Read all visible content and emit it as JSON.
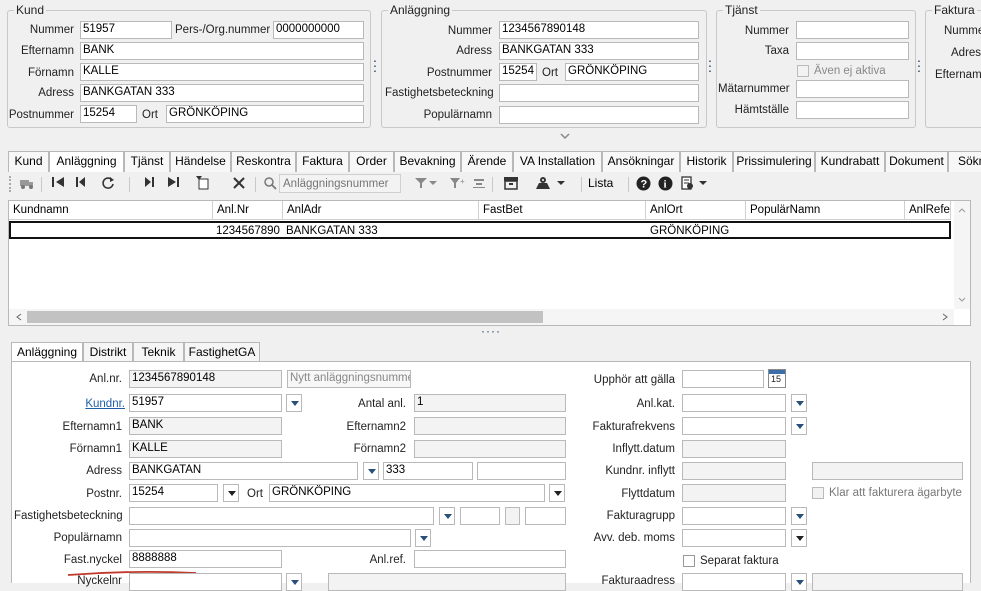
{
  "kund": {
    "title": "Kund",
    "nummer_label": "Nummer",
    "nummer": "51957",
    "persorg_label": "Pers-/Org.nummer",
    "persorg": "0000000000",
    "efternamn_label": "Efternamn",
    "efternamn": "BANK",
    "fornamn_label": "Förnamn",
    "fornamn": "KALLE",
    "adress_label": "Adress",
    "adress": "BANKGATAN 333",
    "postnummer_label": "Postnummer",
    "postnummer": "15254",
    "ort_label": "Ort",
    "ort": "GRÖNKÖPING"
  },
  "anlaggning": {
    "title": "Anläggning",
    "nummer_label": "Nummer",
    "nummer": "1234567890148",
    "adress_label": "Adress",
    "adress": "BANKGATAN 333",
    "postnummer_label": "Postnummer",
    "postnummer": "15254",
    "ort_label": "Ort",
    "ort": "GRÖNKÖPING",
    "fastighet_label": "Fastighetsbeteckning",
    "fastighet": "",
    "popular_label": "Populärnamn",
    "popular": ""
  },
  "tjanst": {
    "title": "Tjänst",
    "nummer_label": "Nummer",
    "taxa_label": "Taxa",
    "aven_label": "Även ej aktiva",
    "matarnummer_label": "Mätarnummer",
    "hamtstalle_label": "Hämtställe"
  },
  "faktura": {
    "title": "Faktura",
    "nummer_label": "Nummer",
    "adress_label": "Adress",
    "efternamn_label": "Efternamn"
  },
  "tabs": [
    "Kund",
    "Anläggning",
    "Tjänst",
    "Händelse",
    "Reskontra",
    "Faktura",
    "Order",
    "Bevakning",
    "Ärende",
    "VA Installation",
    "Ansökningar",
    "Historik",
    "Prissimulering",
    "Kundrabatt",
    "Dokument",
    "Sökn"
  ],
  "toolbar": {
    "search_placeholder": "Anläggningsnummer",
    "lista_label": "Lista"
  },
  "grid": {
    "columns": [
      "Kundnamn",
      "Anl.Nr",
      "AnlAdr",
      "FastBet",
      "AnlOrt",
      "PopulärNamn",
      "AnlRefere"
    ],
    "rows": [
      [
        "",
        "1234567890",
        "BANKGATAN 333",
        "",
        "GRÖNKÖPING",
        "",
        ""
      ]
    ]
  },
  "subtabs": [
    "Anläggning",
    "Distrikt",
    "Teknik",
    "FastighetGA"
  ],
  "form": {
    "anlnr_label": "Anl.nr.",
    "anlnr": "1234567890148",
    "nytt_button": "Nytt anläggningsnummer",
    "kundnr_label": "Kundnr.",
    "kundnr": "51957",
    "antalanl_label": "Antal anl.",
    "antalanl": "1",
    "efternamn1_label": "Efternamn1",
    "efternamn1": "BANK",
    "efternamn2_label": "Efternamn2",
    "efternamn2": "",
    "fornamn1_label": "Förnamn1",
    "fornamn1": "KALLE",
    "fornamn2_label": "Förnamn2",
    "fornamn2": "",
    "adress_label": "Adress",
    "adress": "BANKGATAN",
    "adress_nr": "333",
    "postnr_label": "Postnr.",
    "postnr": "15254",
    "ort_label": "Ort",
    "ort": "GRÖNKÖPING",
    "fastighet_label": "Fastighetsbeteckning",
    "popular_label": "Populärnamn",
    "fastnyckel_label": "Fast.nyckel",
    "fastnyckel": "8888888",
    "anlref_label": "Anl.ref.",
    "nyckelnr_label": "Nyckelnr",
    "upphor_label": "Upphör att gälla",
    "calendar_day": "15",
    "anlkat_label": "Anl.kat.",
    "fakturafrekvens_label": "Fakturafrekvens",
    "inflytt_label": "Inflytt.datum",
    "kundnr_inflytt_label": "Kundnr. inflytt",
    "flyttdatum_label": "Flyttdatum",
    "klar_label": "Klar att fakturera ägarbyte",
    "fakturagrupp_label": "Fakturagrupp",
    "avv_label": "Avv. deb. moms",
    "separat_label": "Separat faktura",
    "fakturaadress_label": "Fakturaadress"
  },
  "colors": {
    "accent": "#1a3d6e",
    "link": "#1f5fa8",
    "highlight_underline": "#c0392b"
  }
}
